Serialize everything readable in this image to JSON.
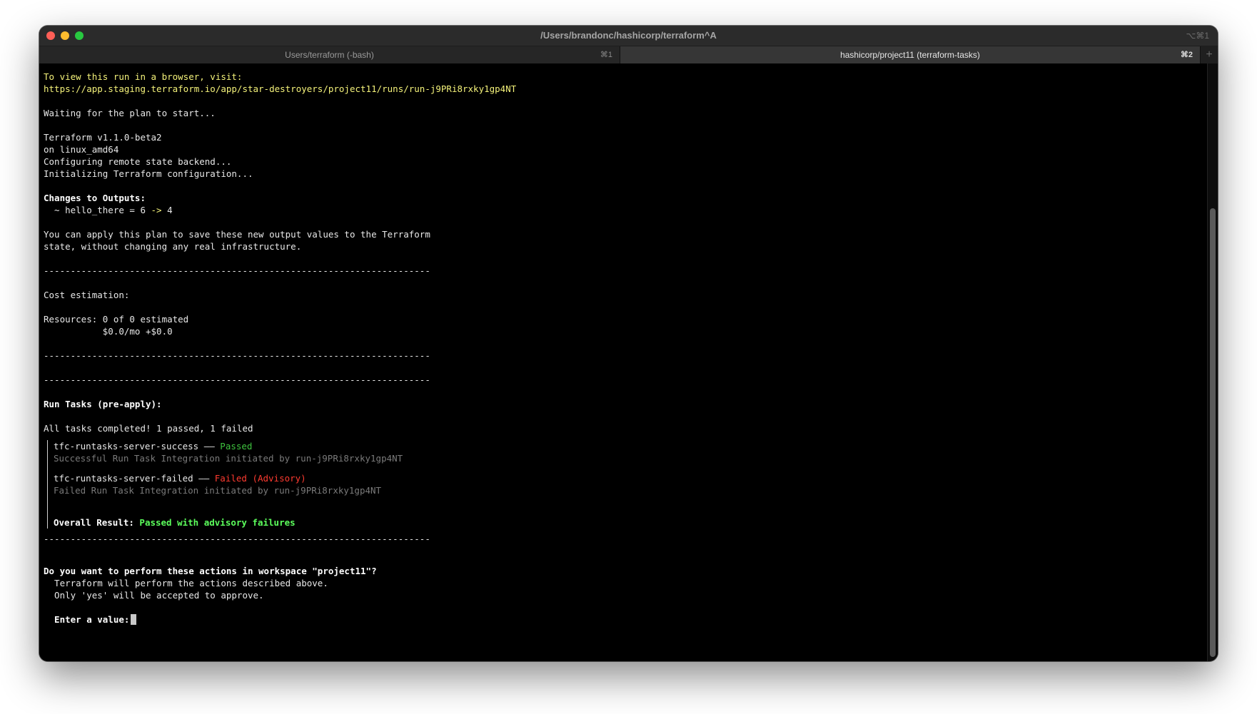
{
  "window": {
    "title": "/Users/brandonc/hashicorp/terraform^A",
    "shortcut": "⌥⌘1"
  },
  "tabs": [
    {
      "label": "Users/terraform (-bash)",
      "shortcut": "⌘1"
    },
    {
      "label": "hashicorp/project11 (terraform-tasks)",
      "shortcut": "⌘2"
    }
  ],
  "new_tab_icon": "+",
  "terminal": {
    "browser_prompt": "To view this run in a browser, visit:",
    "run_url": "https://app.staging.terraform.io/app/star-destroyers/project11/runs/run-j9PRi8rxky1gp4NT",
    "waiting": "Waiting for the plan to start...",
    "tf_version": "Terraform v1.1.0-beta2",
    "platform": "on linux_amd64",
    "configuring": "Configuring remote state backend...",
    "initializing": "Initializing Terraform configuration...",
    "changes_header": "Changes to Outputs:",
    "change_prefix": "  ~ hello_there = 6 ",
    "change_arrow": "->",
    "change_suffix": " 4",
    "apply_note_1": "You can apply this plan to save these new output values to the Terraform",
    "apply_note_2": "state, without changing any real infrastructure.",
    "separator": "------------------------------------------------------------------------",
    "cost_header": "Cost estimation:",
    "resources": "Resources: 0 of 0 estimated",
    "cost": "           $0.0/mo +$0.0",
    "tasks_header": "Run Tasks (pre-apply):",
    "tasks_summary": "All tasks completed! 1 passed, 1 failed",
    "task1_name": "tfc-runtasks-server-success ——",
    "task1_status": " Passed",
    "task1_detail": "Successful Run Task Integration initiated by run-j9PRi8rxky1gp4NT",
    "task2_name": "tfc-runtasks-server-failed ——",
    "task2_status": " Failed (Advisory)",
    "task2_detail": "Failed Run Task Integration initiated by run-j9PRi8rxky1gp4NT",
    "overall_label": "Overall Result:",
    "overall_value": " Passed with advisory failures",
    "confirm_question": "Do you want to perform these actions in workspace \"project11\"?",
    "confirm_line_1": "  Terraform will perform the actions described above.",
    "confirm_line_2": "  Only 'yes' will be accepted to approve.",
    "input_prompt": "  Enter a value:"
  }
}
